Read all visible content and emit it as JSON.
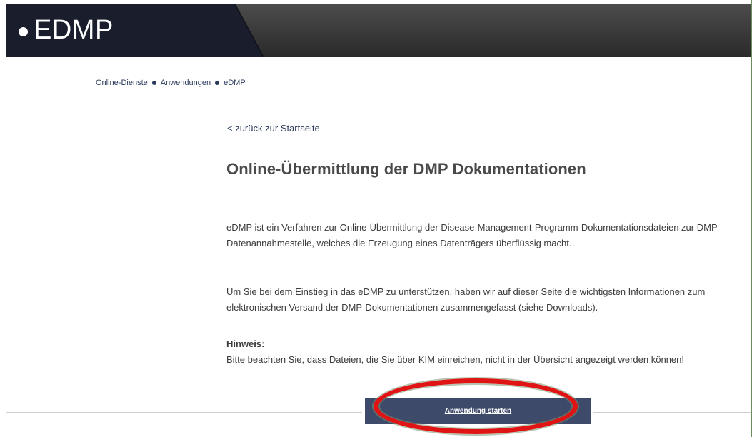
{
  "header": {
    "brand": "EDMP"
  },
  "breadcrumb": {
    "items": [
      "Online-Dienste",
      "Anwendungen",
      "eDMP"
    ]
  },
  "main": {
    "back_link": "< zurück zur Startseite",
    "title": "Online-Übermittlung der DMP Dokumentationen",
    "paragraph1": "eDMP ist ein Verfahren zur Online-Übermittlung der Disease-Management-Programm-Dokumentationsdateien zur DMP Datenannahmestelle, welches die Erzeugung eines Datenträgers überflüssig macht.",
    "paragraph2": "Um Sie bei dem Einstieg in das eDMP zu unterstützen, haben wir auf dieser Seite die wichtigsten Informationen zum elektronischen Versand der DMP-Dokumentationen zusammengefasst (siehe Downloads).",
    "hint_label": "Hinweis:",
    "hint_text": "Bitte beachten Sie, dass Dateien, die Sie über KIM einreichen, nicht in der Übersicht angezeigt werden können!",
    "start_button": "Anwendung starten"
  },
  "colors": {
    "header_dark": "#1a1e2c",
    "header_gray": "#3a3a3a",
    "link": "#2c3a5c",
    "button": "#3e4a6a",
    "highlight": "#e01414"
  }
}
